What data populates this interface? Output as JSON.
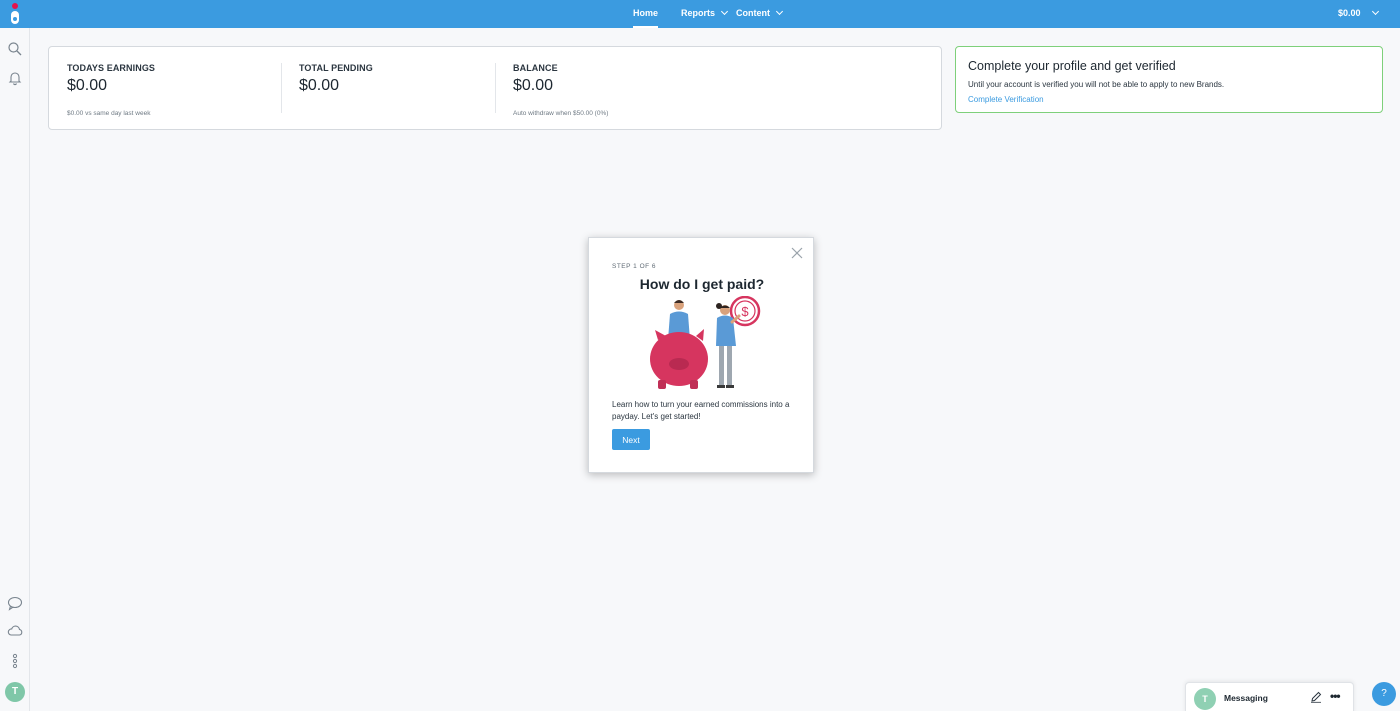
{
  "nav": {
    "home": "Home",
    "reports": "Reports",
    "content": "Content",
    "balance": "$0.00"
  },
  "stats": {
    "todays_earnings": {
      "label": "TODAYS EARNINGS",
      "value": "$0.00",
      "note": "$0.00 vs same day last week"
    },
    "total_pending": {
      "label": "TOTAL PENDING",
      "value": "$0.00"
    },
    "balance": {
      "label": "BALANCE",
      "value": "$0.00",
      "note": "Auto withdraw when $50.00 (0%)"
    }
  },
  "verify": {
    "title": "Complete your profile and get verified",
    "text": "Until your account is verified you will not be able to apply to new Brands.",
    "link": "Complete Verification"
  },
  "modal": {
    "step": "STEP 1 OF 6",
    "title": "How do I get paid?",
    "text": "Learn how to turn your earned commissions into a payday. Let's get started!",
    "next": "Next"
  },
  "rail": {
    "avatar_initial": "T"
  },
  "messaging": {
    "avatar_initial": "T",
    "label": "Messaging",
    "more": "•••"
  },
  "help": {
    "label": "?"
  },
  "colors": {
    "brand_blue": "#3b9be0",
    "brand_red": "#e5134d",
    "verify_green": "#7ed07a",
    "piggy_pink": "#d6355f"
  },
  "icons": [
    "search-icon",
    "bell-icon",
    "chat-icon",
    "cloud-icon",
    "more-vertical-icon",
    "close-icon",
    "edit-icon",
    "chevron-down-icon"
  ]
}
